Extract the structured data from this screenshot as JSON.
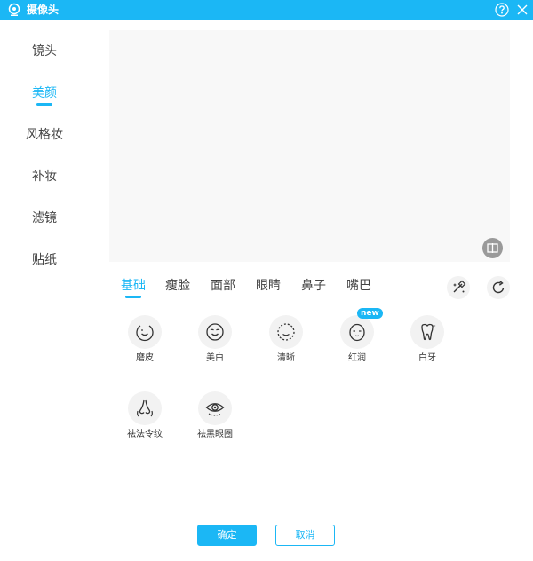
{
  "window": {
    "title": "摄像头",
    "icons": [
      "webcam-icon",
      "help-icon",
      "close-icon"
    ]
  },
  "sidebar": {
    "items": [
      {
        "label": "镜头",
        "active": false
      },
      {
        "label": "美颜",
        "active": true
      },
      {
        "label": "风格妆",
        "active": false
      },
      {
        "label": "补妆",
        "active": false
      },
      {
        "label": "滤镜",
        "active": false
      },
      {
        "label": "贴纸",
        "active": false
      }
    ]
  },
  "preview": {
    "compare_icon": "compare-icon"
  },
  "tabs": [
    {
      "label": "基础",
      "active": true
    },
    {
      "label": "瘦脸",
      "active": false
    },
    {
      "label": "面部",
      "active": false
    },
    {
      "label": "眼睛",
      "active": false
    },
    {
      "label": "鼻子",
      "active": false
    },
    {
      "label": "嘴巴",
      "active": false
    }
  ],
  "tools": {
    "icons": [
      "magic-wand-icon",
      "reset-icon"
    ]
  },
  "features": [
    {
      "label": "磨皮",
      "icon": "face-smooth-icon"
    },
    {
      "label": "美白",
      "icon": "face-whiten-icon"
    },
    {
      "label": "清晰",
      "icon": "face-sharpen-icon"
    },
    {
      "label": "红润",
      "icon": "face-rosy-icon",
      "badge": "new"
    },
    {
      "label": "白牙",
      "icon": "tooth-icon"
    },
    {
      "label": "祛法令纹",
      "icon": "nasolabial-icon"
    },
    {
      "label": "祛黑眼圈",
      "icon": "eye-icon"
    }
  ],
  "buttons": {
    "confirm": "确定",
    "cancel": "取消"
  },
  "colors": {
    "accent": "#1bb7f5",
    "preview_bg": "#f8f8f8",
    "icon_bg": "#f2f2f2"
  }
}
